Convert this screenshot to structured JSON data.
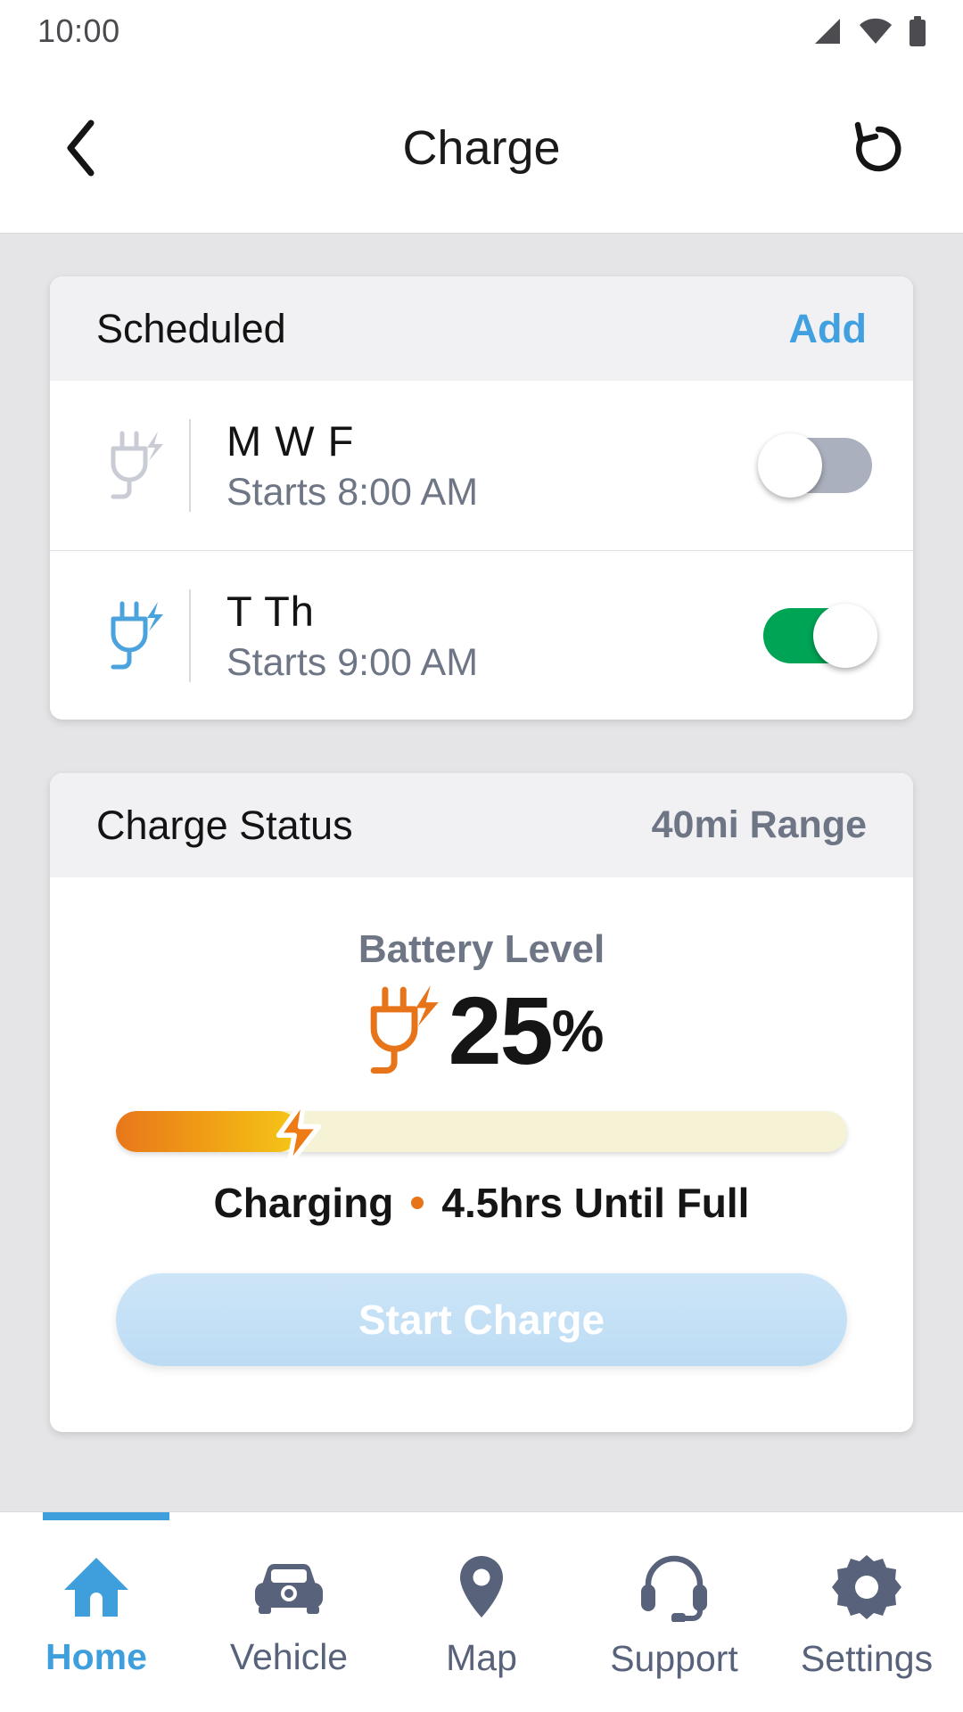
{
  "status_bar": {
    "time": "10:00",
    "icons": [
      "signal-icon",
      "wifi-icon",
      "battery-icon"
    ]
  },
  "app_bar": {
    "back_icon": "chevron-left-icon",
    "title": "Charge",
    "refresh_icon": "history-refresh-icon"
  },
  "scheduled_card": {
    "title": "Scheduled",
    "add_label": "Add",
    "rows": [
      {
        "icon": "plug-charge-icon",
        "icon_color": "#c9ccd4",
        "days": "M W F",
        "start": "Starts 8:00 AM",
        "toggle_state": "off"
      },
      {
        "icon": "plug-charge-icon",
        "icon_color": "#4ba3dd",
        "days": "T Th",
        "start": "Starts 9:00 AM",
        "toggle_state": "on"
      }
    ]
  },
  "charge_status_card": {
    "title": "Charge Status",
    "range": "40mi Range",
    "battery_label": "Battery Level",
    "plug_icon": "plug-charge-icon",
    "battery_value": "25",
    "battery_unit": "%",
    "battery_percent": 25,
    "status_primary": "Charging",
    "status_secondary": "4.5hrs Until Full",
    "bolt_icon": "lightning-bolt-icon",
    "cta_label": "Start Charge"
  },
  "bottom_nav": {
    "items": [
      {
        "label": "Home",
        "icon": "home-icon",
        "active": true
      },
      {
        "label": "Vehicle",
        "icon": "car-icon",
        "active": false
      },
      {
        "label": "Map",
        "icon": "map-pin-icon",
        "active": false
      },
      {
        "label": "Support",
        "icon": "headset-icon",
        "active": false
      },
      {
        "label": "Settings",
        "icon": "gear-icon",
        "active": false
      }
    ]
  },
  "colors": {
    "accent_blue": "#3f9fdc",
    "toggle_on_green": "#00a455",
    "toggle_off_gray": "#aab0bd",
    "charge_orange": "#e8741a",
    "charge_yellow": "#f5c717",
    "page_bg": "#e5e5e7",
    "card_header_bg": "#f1f1f4",
    "muted_text": "#6e7585"
  }
}
